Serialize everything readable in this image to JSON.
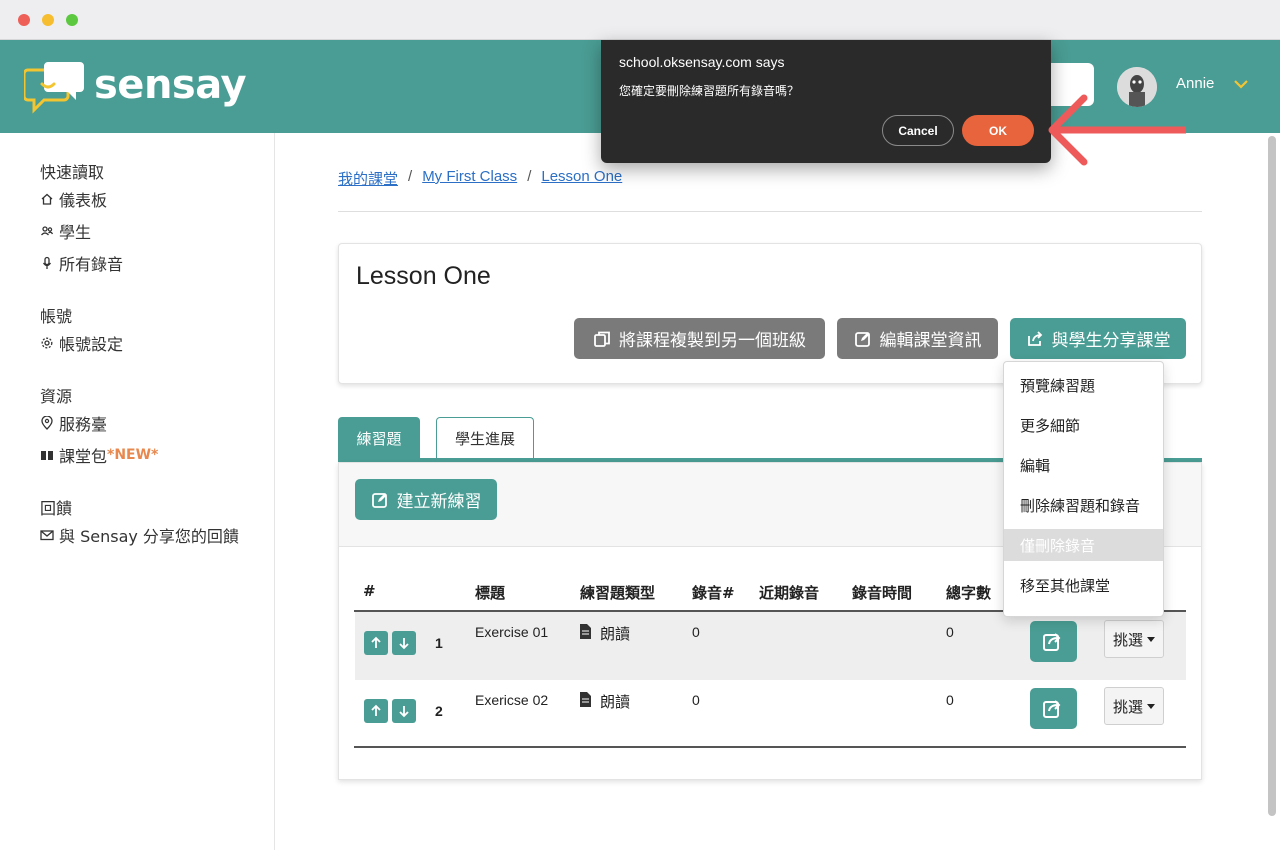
{
  "app": {
    "logo_text": "sensay"
  },
  "user": {
    "name": "Annie"
  },
  "sidebar": {
    "quick_access_heading": "快速讀取",
    "dashboard": "儀表板",
    "students": "學生",
    "all_recordings": "所有錄音",
    "account_heading": "帳號",
    "account_settings": "帳號設定",
    "resources_heading": "資源",
    "help_desk": "服務臺",
    "class_pack": "課堂包",
    "class_pack_new": "*NEW*",
    "feedback_heading": "回饋",
    "share_feedback": "與 Sensay 分享您的回饋"
  },
  "breadcrumb": {
    "home": "我的課堂",
    "class": "My First Class",
    "lesson": "Lesson One",
    "separator": "/"
  },
  "lesson": {
    "title": "Lesson One",
    "copy_button": "將課程複製到另一個班級",
    "edit_button": "編輯課堂資訊",
    "share_button": "與學生分享課堂"
  },
  "dropdown": {
    "items": [
      "預覽練習題",
      "更多細節",
      "編輯",
      "刪除練習題和錄音",
      "僅刪除錄音",
      "移至其他課堂"
    ]
  },
  "tabs": {
    "exercises": "練習題",
    "progress": "學生進展"
  },
  "create_button": "建立新練習",
  "table": {
    "headers": {
      "num": "#",
      "title": "標題",
      "type": "練習題類型",
      "recordings": "錄音#",
      "recent": "近期錄音",
      "time": "錄音時間",
      "words": "總字數"
    },
    "rows": [
      {
        "num": "1",
        "title": "Exercise 01",
        "type": "朗讀",
        "recordings": "0",
        "words": "0",
        "select": "挑選"
      },
      {
        "num": "2",
        "title": "Exericse 02",
        "type": "朗讀",
        "recordings": "0",
        "words": "0",
        "select": "挑選"
      }
    ]
  },
  "dialog": {
    "title": "school.oksensay.com says",
    "message": "您確定要刪除練習題所有錄音嗎？",
    "cancel": "Cancel",
    "ok": "OK"
  },
  "colors": {
    "brand_teal": "#4a9d94",
    "ok_orange": "#e8643c",
    "annotation_red": "#ee5a5a"
  }
}
